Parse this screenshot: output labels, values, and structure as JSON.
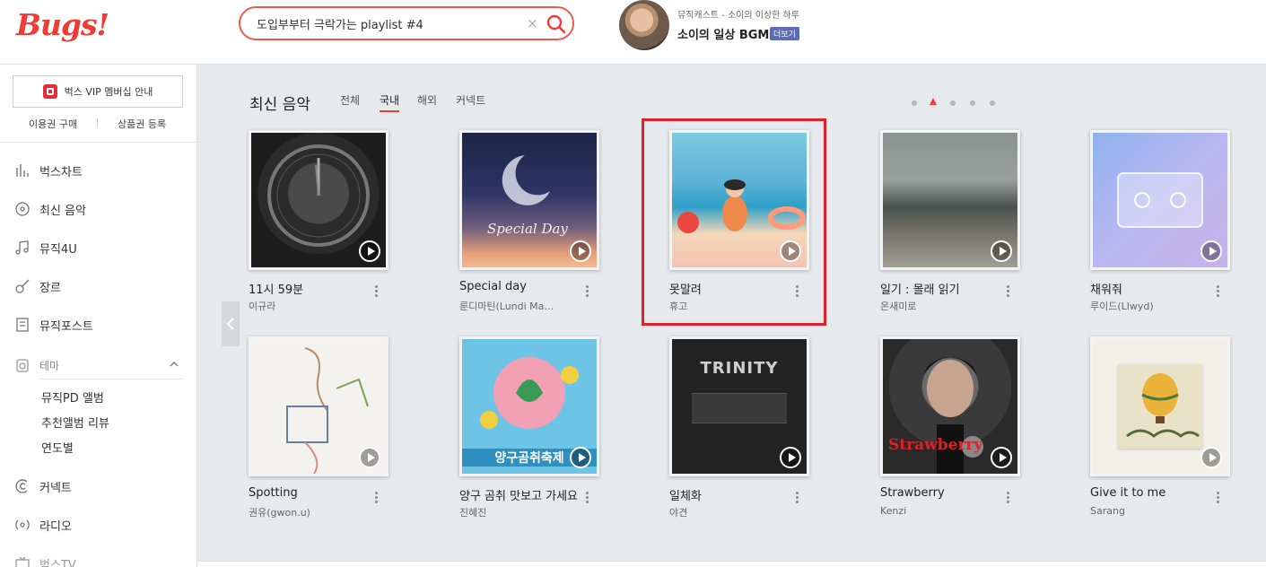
{
  "header": {
    "logo": "Bugs!",
    "search": {
      "value": "도입부부터 극락가는 playlist #4",
      "clear": "×"
    },
    "promo": {
      "caption": "뮤직캐스트 - 소이의 이상한 하루",
      "title": "소이의 일상 BGM",
      "more": "더보기"
    }
  },
  "sidebar": {
    "vip_button": "벅스 VIP 멤버십 안내",
    "sub_links": [
      "이용권 구매",
      "상품권 등록"
    ],
    "nav": [
      {
        "label": "벅스차트",
        "icon": "chart-bars-icon"
      },
      {
        "label": "최신 음악",
        "icon": "new-music-icon"
      },
      {
        "label": "뮤직4U",
        "icon": "music-note-icon"
      },
      {
        "label": "장르",
        "icon": "guitar-icon"
      },
      {
        "label": "뮤직포스트",
        "icon": "post-icon"
      }
    ],
    "theme": {
      "label": "테마",
      "items": [
        "뮤직PD 앨범",
        "추천앨범 리뷰",
        "연도별"
      ]
    },
    "nav2": [
      {
        "label": "커넥트",
        "icon": "connect-icon"
      },
      {
        "label": "라디오",
        "icon": "radio-icon"
      },
      {
        "label": "벅스TV",
        "icon": "tv-icon"
      }
    ]
  },
  "main": {
    "section_title": "최신 음악",
    "tabs": [
      "전체",
      "국내",
      "해외",
      "커넥트"
    ],
    "active_tab": "국내",
    "pager": {
      "count": 5,
      "active_index": 1
    },
    "albums": [
      {
        "title": "11시 59분",
        "artist": "이규라"
      },
      {
        "title": "Special day",
        "artist": "룬디마틴(Lundi Ma…"
      },
      {
        "title": "못말려",
        "artist": "휴고"
      },
      {
        "title": "일기 : 몰래 읽기",
        "artist": "온새미로"
      },
      {
        "title": "채워줘",
        "artist": "루이드(Llwyd)"
      },
      {
        "title": "Spotting",
        "artist": "권유(gwon.u)"
      },
      {
        "title": "양구 곰취 맛보고 가세요",
        "artist": "진혜진"
      },
      {
        "title": "일체화",
        "artist": "야견"
      },
      {
        "title": "Strawberry",
        "artist": "Kenzi"
      },
      {
        "title": "Give it to me",
        "artist": "Sarang"
      }
    ],
    "covers": {
      "c1_text": "",
      "c2_text": "Special Day",
      "c8_text": "TRINITY",
      "c9_text": "Strawberry",
      "c7_text": "양구곰취축제"
    },
    "accent": "#ef3b36"
  }
}
